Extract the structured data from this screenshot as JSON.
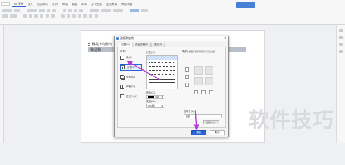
{
  "ribbon": {
    "tabs": [
      "开始",
      "插入",
      "页面布局",
      "引用",
      "审阅",
      "视图",
      "章节",
      "开发工具",
      "会员专享",
      "特色功能"
    ],
    "active_tab": 0
  },
  "document": {
    "line1": "我是个利雷利",
    "line2": "我是我"
  },
  "dialog": {
    "title": "边框和底纹",
    "close": "×",
    "tabs": [
      "边框(B)",
      "页面边框(P)",
      "底纹(S)"
    ],
    "settings_label": "设置:",
    "settings": [
      "无(N)",
      "方框(X)",
      "全部(A)",
      "网格(D)",
      "自定义(U)"
    ],
    "style_label": "线型(Y):",
    "color_label": "颜色(C):",
    "color_value": "自动",
    "width_label": "宽度(W):",
    "width_value": "0.5 磅",
    "preview_label": "预览",
    "preview_hint": "单击下方图示或使用按钮可设置边框",
    "apply_label": "应用于(L):",
    "apply_value": "段落",
    "options_button": "选项(O)...",
    "ok": "确定",
    "cancel": "取消"
  },
  "watermark": "软件技巧",
  "colors": {
    "accent": "#2a63d6",
    "arrow": "#b53bd6",
    "selected_row": "#b9bfc9"
  },
  "icons": {
    "settings": [
      "none-icon",
      "box-icon",
      "all-borders-icon",
      "grid-icon",
      "custom-border-icon"
    ]
  }
}
